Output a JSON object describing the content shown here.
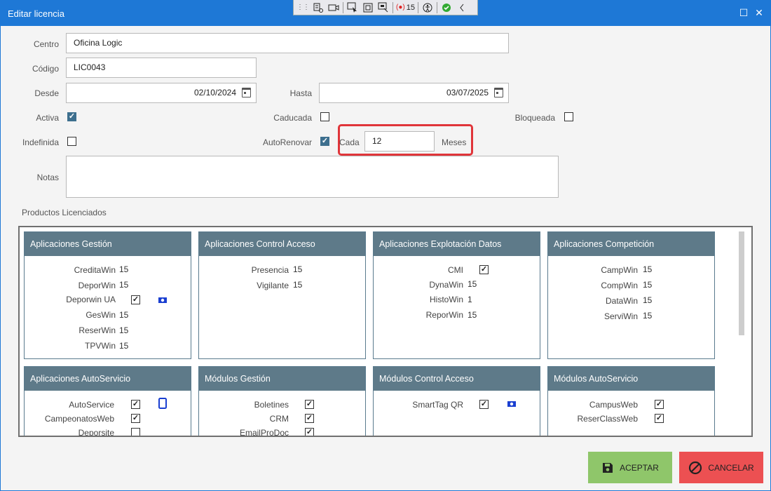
{
  "window": {
    "title": "Editar licencia",
    "maximize_glyph": "☐",
    "close_glyph": "✕"
  },
  "devtools": {
    "count": "15"
  },
  "form": {
    "centro_label": "Centro",
    "centro_value": "Oficina Logic",
    "codigo_label": "Código",
    "codigo_value": "LIC0043",
    "desde_label": "Desde",
    "desde_value": "02/10/2024",
    "hasta_label": "Hasta",
    "hasta_value": "03/07/2025",
    "activa_label": "Activa",
    "activa_checked": true,
    "caducada_label": "Caducada",
    "caducada_checked": false,
    "bloqueada_label": "Bloqueada",
    "bloqueada_checked": false,
    "indefinida_label": "Indefinida",
    "indefinida_checked": false,
    "autorenovar_label": "AutoRenovar",
    "autorenovar_checked": true,
    "cada_label": "Cada",
    "cada_value": "12",
    "meses_label": "Meses",
    "notas_label": "Notas",
    "productos_label": "Productos Licenciados"
  },
  "cards": {
    "c1": {
      "title": "Aplicaciones Gestión",
      "rows": [
        {
          "name": "CreditaWin",
          "value": "15"
        },
        {
          "name": "DeporWin",
          "value": "15"
        },
        {
          "name": "Deporwin UA",
          "checked": true,
          "icon": "money-icon"
        },
        {
          "name": "GesWin",
          "value": "15"
        },
        {
          "name": "ReserWin",
          "value": "15"
        },
        {
          "name": "TPVWin",
          "value": "15"
        }
      ]
    },
    "c2": {
      "title": "Aplicaciones Control Acceso",
      "rows": [
        {
          "name": "Presencia",
          "value": "15"
        },
        {
          "name": "Vigilante",
          "value": "15"
        }
      ]
    },
    "c3": {
      "title": "Aplicaciones Explotación Datos",
      "rows": [
        {
          "name": "CMI",
          "checked": true
        },
        {
          "name": "DynaWin",
          "value": "15"
        },
        {
          "name": "HistoWin",
          "value": "1"
        },
        {
          "name": "ReporWin",
          "value": "15"
        }
      ]
    },
    "c4": {
      "title": "Aplicaciones Competición",
      "rows": [
        {
          "name": "CampWin",
          "value": "15"
        },
        {
          "name": "CompWin",
          "value": "15"
        },
        {
          "name": "DataWin",
          "value": "15"
        },
        {
          "name": "ServiWin",
          "value": "15"
        }
      ]
    },
    "c5": {
      "title": "Aplicaciones AutoServicio",
      "rows": [
        {
          "name": "AutoService",
          "checked": true,
          "icon": "tablet-icon"
        },
        {
          "name": "CampeonatosWeb",
          "checked": true
        },
        {
          "name": "Deporsite",
          "checked": false
        }
      ]
    },
    "c6": {
      "title": "Módulos Gestión",
      "rows": [
        {
          "name": "Boletines",
          "checked": true
        },
        {
          "name": "CRM",
          "checked": true
        },
        {
          "name": "EmailProDoc",
          "checked": true
        }
      ]
    },
    "c7": {
      "title": "Módulos Control Acceso",
      "rows": [
        {
          "name": "SmartTag QR",
          "checked": true,
          "icon": "money-icon"
        }
      ]
    },
    "c8": {
      "title": "Módulos AutoServicio",
      "rows": [
        {
          "name": "CampusWeb",
          "checked": true
        },
        {
          "name": "ReserClassWeb",
          "checked": true
        }
      ]
    }
  },
  "buttons": {
    "accept": "ACEPTAR",
    "cancel": "CANCELAR"
  },
  "colors": {
    "titlebar": "#1e78d6",
    "card_header": "#5e7a89",
    "accept": "#8fc66a",
    "cancel": "#ec5052",
    "highlight": "#e0353a"
  }
}
